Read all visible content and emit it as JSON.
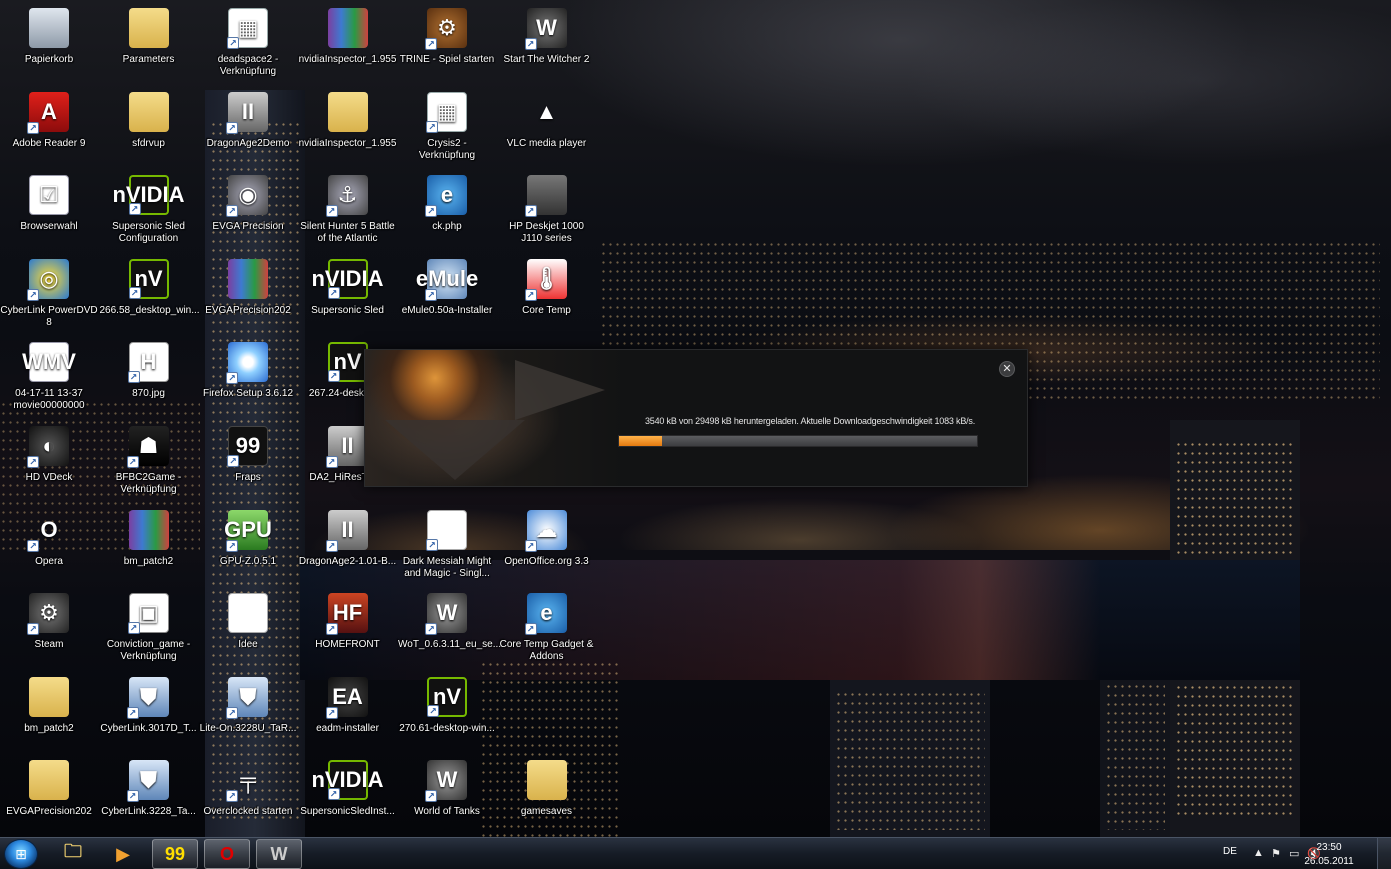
{
  "desktop": {
    "icons": [
      {
        "label": "Papierkorb",
        "icon": "recycle-bin-icon",
        "glyph": "",
        "cls": "g-recycle",
        "shortcut": false,
        "col": 0,
        "row": 0
      },
      {
        "label": "Parameters",
        "icon": "folder-icon",
        "glyph": "",
        "cls": "g-folder",
        "shortcut": false,
        "col": 1,
        "row": 0
      },
      {
        "label": "deadspace2 - Verknüpfung",
        "icon": "document-icon",
        "glyph": "▦",
        "cls": "g-doc",
        "shortcut": true,
        "col": 2,
        "row": 0
      },
      {
        "label": "nvidiaInspector_1.955",
        "icon": "winrar-archive-icon",
        "glyph": "",
        "cls": "g-rar",
        "shortcut": false,
        "col": 3,
        "row": 0
      },
      {
        "label": "TRINE - Spiel starten",
        "icon": "trine-gear-icon",
        "glyph": "⚙",
        "cls": "g-gear",
        "shortcut": true,
        "col": 4,
        "row": 0
      },
      {
        "label": "Start The Witcher 2",
        "icon": "witcher-medallion-icon",
        "glyph": "W",
        "cls": "g-witcher",
        "shortcut": true,
        "col": 5,
        "row": 0
      },
      {
        "label": "Adobe Reader 9",
        "icon": "adobe-reader-icon",
        "glyph": "A",
        "cls": "g-pdf",
        "shortcut": true,
        "col": 0,
        "row": 1
      },
      {
        "label": "sfdrvup",
        "icon": "folder-icon",
        "glyph": "",
        "cls": "g-folder",
        "shortcut": false,
        "col": 1,
        "row": 1
      },
      {
        "label": "DragonAge2Demo",
        "icon": "dragon-age-icon",
        "glyph": "II",
        "cls": "g-roman",
        "shortcut": true,
        "col": 2,
        "row": 1
      },
      {
        "label": "nvidiaInspector_1.955",
        "icon": "folder-icon",
        "glyph": "",
        "cls": "g-folder",
        "shortcut": false,
        "col": 3,
        "row": 1
      },
      {
        "label": "Crysis2 - Verknüpfung",
        "icon": "document-icon",
        "glyph": "▦",
        "cls": "g-doc",
        "shortcut": true,
        "col": 4,
        "row": 1
      },
      {
        "label": "VLC media player",
        "icon": "vlc-cone-icon",
        "glyph": "▲",
        "cls": "g-vlc",
        "shortcut": false,
        "col": 5,
        "row": 1
      },
      {
        "label": "Browserwahl",
        "icon": "checklist-icon",
        "glyph": "☑",
        "cls": "g-list",
        "shortcut": false,
        "col": 0,
        "row": 2
      },
      {
        "label": "Supersonic Sled Configuration",
        "icon": "nvidia-icon",
        "glyph": "nVIDIA",
        "cls": "g-nvidia",
        "shortcut": true,
        "col": 1,
        "row": 2
      },
      {
        "label": "EVGA Precision",
        "icon": "evga-precision-icon",
        "glyph": "◉",
        "cls": "g-evga",
        "shortcut": true,
        "col": 2,
        "row": 2
      },
      {
        "label": "Silent Hunter 5 Battle of the Atlantic",
        "icon": "silent-hunter-icon",
        "glyph": "⚓",
        "cls": "g-evga",
        "shortcut": true,
        "col": 3,
        "row": 2
      },
      {
        "label": "ck.php",
        "icon": "internet-explorer-icon",
        "glyph": "e",
        "cls": "g-ie",
        "shortcut": true,
        "col": 4,
        "row": 2
      },
      {
        "label": "HP Deskjet 1000 J110 series",
        "icon": "printer-icon",
        "glyph": "",
        "cls": "g-printer",
        "shortcut": true,
        "col": 5,
        "row": 2
      },
      {
        "label": "CyberLink PowerDVD 8",
        "icon": "powerdvd-icon",
        "glyph": "◎",
        "cls": "g-dvd",
        "shortcut": true,
        "col": 0,
        "row": 3
      },
      {
        "label": "266.58_desktop_win...",
        "icon": "nvidia-installer-icon",
        "glyph": "nV",
        "cls": "g-nvidia",
        "shortcut": true,
        "col": 1,
        "row": 3
      },
      {
        "label": "EVGAPrecision202",
        "icon": "winrar-archive-icon",
        "glyph": "",
        "cls": "g-rar",
        "shortcut": false,
        "col": 2,
        "row": 3
      },
      {
        "label": "Supersonic Sled",
        "icon": "nvidia-icon",
        "glyph": "nVIDIA",
        "cls": "g-nvidia",
        "shortcut": true,
        "col": 3,
        "row": 3
      },
      {
        "label": "eMule0.50a-Installer",
        "icon": "emule-icon",
        "glyph": "eMule",
        "cls": "g-emule",
        "shortcut": true,
        "col": 4,
        "row": 3
      },
      {
        "label": "Core Temp",
        "icon": "thermometer-icon",
        "glyph": "🌡",
        "cls": "g-temp",
        "shortcut": true,
        "col": 5,
        "row": 3
      },
      {
        "label": "04-17-11 13-37 movie00000000",
        "icon": "wmv-video-icon",
        "glyph": "WMV",
        "cls": "g-wmv",
        "shortcut": false,
        "col": 0,
        "row": 4
      },
      {
        "label": "870.jpg",
        "icon": "image-file-icon",
        "glyph": "H",
        "cls": "g-jpg",
        "shortcut": true,
        "col": 1,
        "row": 4
      },
      {
        "label": "Firefox Setup 3.6.12",
        "icon": "installer-disc-icon",
        "glyph": "",
        "cls": "g-disc",
        "shortcut": true,
        "col": 2,
        "row": 4
      },
      {
        "label": "267.24-desktop...",
        "icon": "nvidia-installer-icon",
        "glyph": "nV",
        "cls": "g-nvidia",
        "shortcut": true,
        "col": 3,
        "row": 4
      },
      {
        "label": "HD VDeck",
        "icon": "hd-vdeck-icon",
        "glyph": "◐",
        "cls": "g-hdv",
        "shortcut": true,
        "col": 0,
        "row": 5
      },
      {
        "label": "BFBC2Game - Verknüpfung",
        "icon": "battlefield-icon",
        "glyph": "☗",
        "cls": "g-bf",
        "shortcut": true,
        "col": 1,
        "row": 5
      },
      {
        "label": "Fraps",
        "icon": "fraps-icon",
        "glyph": "99",
        "cls": "g-fraps",
        "shortcut": true,
        "col": 2,
        "row": 5
      },
      {
        "label": "DA2_HiResTex...",
        "icon": "dragon-age-icon",
        "glyph": "II",
        "cls": "g-roman",
        "shortcut": true,
        "col": 3,
        "row": 5
      },
      {
        "label": "Opera",
        "icon": "opera-icon",
        "glyph": "O",
        "cls": "g-opera",
        "shortcut": true,
        "col": 0,
        "row": 6
      },
      {
        "label": "bm_patch2",
        "icon": "winrar-archive-icon",
        "glyph": "",
        "cls": "g-rar",
        "shortcut": false,
        "col": 1,
        "row": 6
      },
      {
        "label": "GPU-Z.0.5.1",
        "icon": "gpu-z-icon",
        "glyph": "GPU",
        "cls": "g-gpuz",
        "shortcut": true,
        "col": 2,
        "row": 6
      },
      {
        "label": "DragonAge2-1.01-B...",
        "icon": "dragon-age-icon",
        "glyph": "II",
        "cls": "g-roman",
        "shortcut": true,
        "col": 3,
        "row": 6
      },
      {
        "label": "Dark Messiah Might and Magic - Singl...",
        "icon": "blank-document-icon",
        "glyph": "",
        "cls": "g-blank",
        "shortcut": true,
        "col": 4,
        "row": 6
      },
      {
        "label": "OpenOffice.org 3.3",
        "icon": "openoffice-icon",
        "glyph": "☁",
        "cls": "g-oo",
        "shortcut": true,
        "col": 5,
        "row": 6
      },
      {
        "label": "Steam",
        "icon": "steam-icon",
        "glyph": "⚙",
        "cls": "g-steam",
        "shortcut": true,
        "col": 0,
        "row": 7
      },
      {
        "label": "Conviction_game - Verknüpfung",
        "icon": "conviction-icon",
        "glyph": "▣",
        "cls": "g-conv",
        "shortcut": true,
        "col": 1,
        "row": 7
      },
      {
        "label": "Idee",
        "icon": "blank-document-icon",
        "glyph": "",
        "cls": "g-blank",
        "shortcut": false,
        "col": 2,
        "row": 7
      },
      {
        "label": "HOMEFRONT",
        "icon": "homefront-icon",
        "glyph": "HF",
        "cls": "g-hf",
        "shortcut": true,
        "col": 3,
        "row": 7
      },
      {
        "label": "WoT_0.6.3.11_eu_se...",
        "icon": "world-of-tanks-icon",
        "glyph": "W",
        "cls": "g-wot",
        "shortcut": true,
        "col": 4,
        "row": 7
      },
      {
        "label": "Core Temp Gadget & Addons",
        "icon": "internet-explorer-icon",
        "glyph": "e",
        "cls": "g-ie",
        "shortcut": true,
        "col": 5,
        "row": 7
      },
      {
        "label": "bm_patch2",
        "icon": "folder-icon",
        "glyph": "",
        "cls": "g-folder",
        "shortcut": false,
        "col": 0,
        "row": 8
      },
      {
        "label": "CyberLink.3017D_T...",
        "icon": "installer-shield-icon",
        "glyph": "⛊",
        "cls": "g-shield",
        "shortcut": true,
        "col": 1,
        "row": 8
      },
      {
        "label": "Lite-On.3228U_TaR...",
        "icon": "installer-shield-icon",
        "glyph": "⛊",
        "cls": "g-shield",
        "shortcut": true,
        "col": 2,
        "row": 8
      },
      {
        "label": "eadm-installer",
        "icon": "ea-icon",
        "glyph": "EA",
        "cls": "g-ea",
        "shortcut": true,
        "col": 3,
        "row": 8
      },
      {
        "label": "270.61-desktop-win...",
        "icon": "nvidia-installer-icon",
        "glyph": "nV",
        "cls": "g-nvidia",
        "shortcut": true,
        "col": 4,
        "row": 8
      },
      {
        "label": "EVGAPrecision202",
        "icon": "folder-icon",
        "glyph": "",
        "cls": "g-folder",
        "shortcut": false,
        "col": 0,
        "row": 9
      },
      {
        "label": "CyberLink.3228_Ta...",
        "icon": "installer-shield-icon",
        "glyph": "⛊",
        "cls": "g-shield",
        "shortcut": true,
        "col": 1,
        "row": 9
      },
      {
        "label": "Overclocked starten",
        "icon": "pistol-icon",
        "glyph": "╤",
        "cls": "g-gun",
        "shortcut": true,
        "col": 2,
        "row": 9
      },
      {
        "label": "SupersonicSledInst...",
        "icon": "nvidia-icon",
        "glyph": "nVIDIA",
        "cls": "g-nvidia",
        "shortcut": true,
        "col": 3,
        "row": 9
      },
      {
        "label": "World of Tanks",
        "icon": "world-of-tanks-icon",
        "glyph": "W",
        "cls": "g-wot",
        "shortcut": true,
        "col": 4,
        "row": 9
      },
      {
        "label": "gamesaves",
        "icon": "folder-icon",
        "glyph": "",
        "cls": "g-folder",
        "shortcut": false,
        "col": 5,
        "row": 9
      }
    ]
  },
  "download_dialog": {
    "status": "3540 kB von 29498 kB heruntergeladen. Aktuelle Downloadgeschwindigkeit 1083 kB/s.",
    "progress": 0.12,
    "close_glyph": "✕",
    "accent_color": "#f39a2a"
  },
  "taskbar": {
    "start_icon": "windows-logo-icon",
    "buttons": [
      {
        "icon": "explorer-folder-icon",
        "glyph": "🗀",
        "color": "#f0d070",
        "active": false
      },
      {
        "icon": "media-player-icon",
        "glyph": "▶",
        "color": "#f0a030",
        "active": false
      },
      {
        "icon": "fraps-icon",
        "glyph": "99",
        "color": "#ffde00",
        "active": true
      },
      {
        "icon": "opera-icon",
        "glyph": "O",
        "color": "#e00000",
        "active": true
      },
      {
        "icon": "witcher-medallion-icon",
        "glyph": "W",
        "color": "#cccccc",
        "active": true
      }
    ],
    "tray": {
      "language": "DE",
      "time": "23:50",
      "date": "26.05.2011"
    }
  }
}
